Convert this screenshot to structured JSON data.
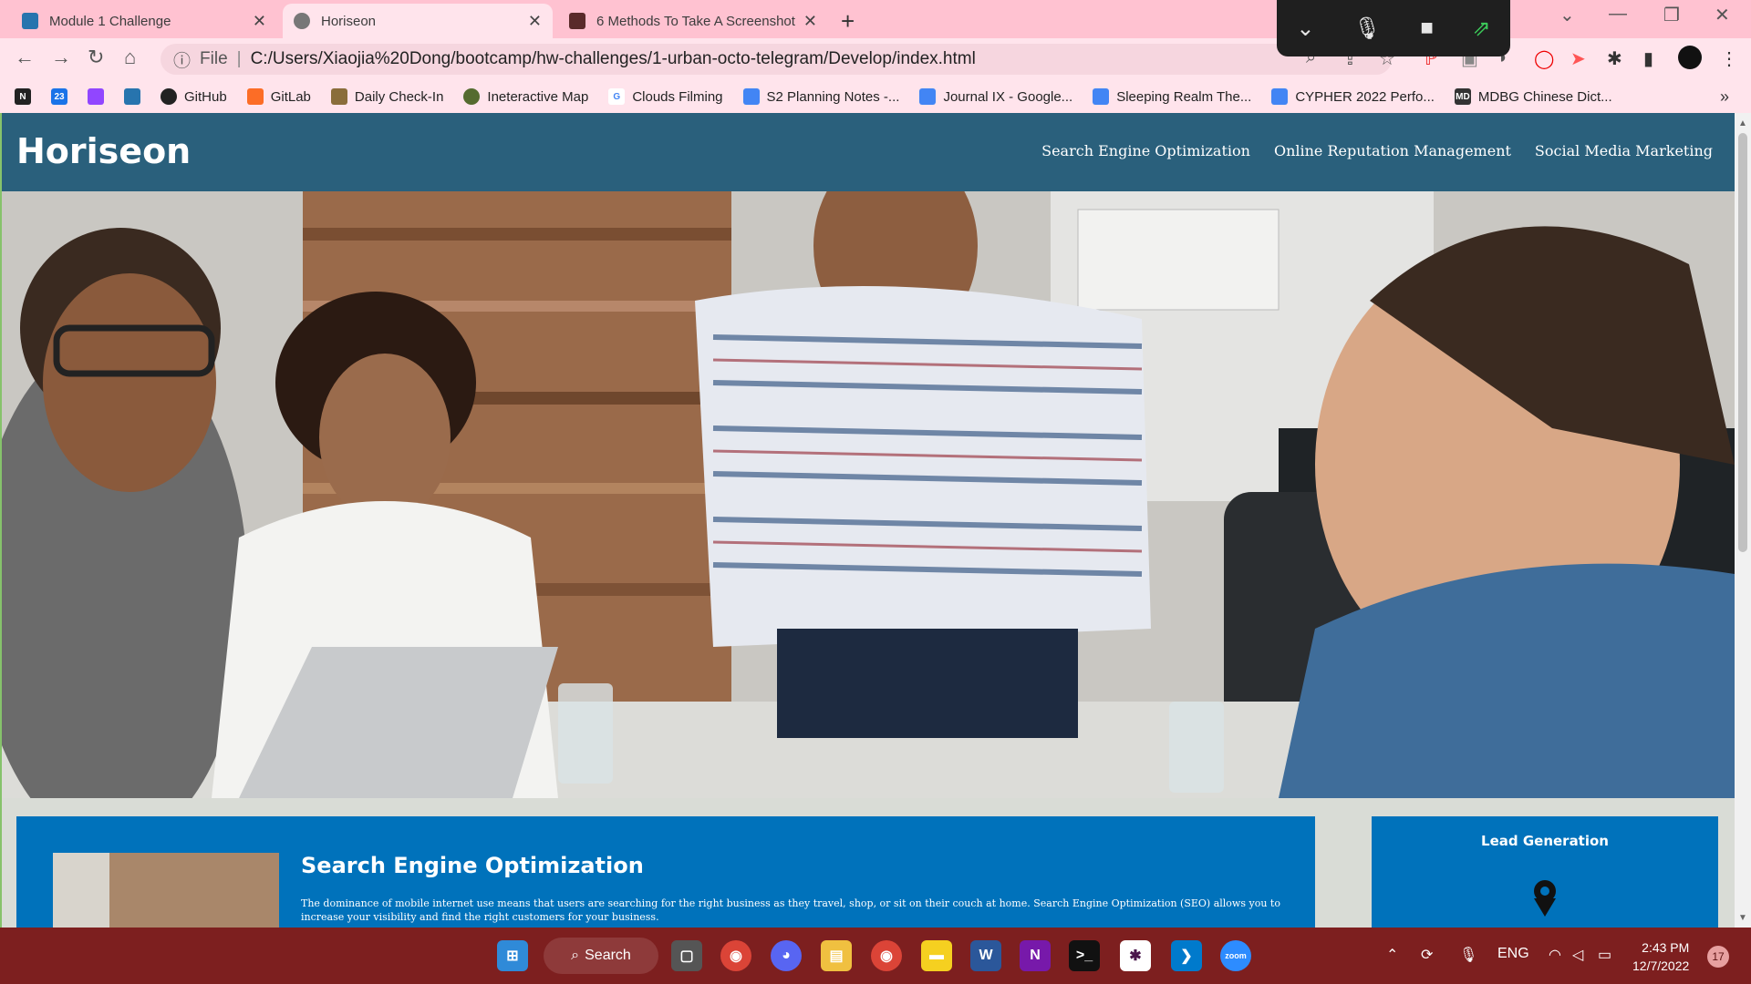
{
  "browser": {
    "tabs": [
      {
        "title": "Module 1 Challenge",
        "favicon": "ucla-icon",
        "active": false
      },
      {
        "title": "Horiseon",
        "favicon": "globe-icon",
        "active": true
      },
      {
        "title": "6 Methods To Take A Screenshot",
        "favicon": "screenshot-site-icon",
        "active": false
      }
    ],
    "url": {
      "scheme": "File",
      "path": "C:/Users/Xiaojia%20Dong/bootcamp/hw-challenges/1-urban-octo-telegram/Develop/index.html"
    },
    "bookmarks": [
      {
        "label": "",
        "icon": "notion-icon",
        "color": "#222222"
      },
      {
        "label": "",
        "icon": "calendar-icon",
        "color": "#1a73e8"
      },
      {
        "label": "",
        "icon": "twitch-icon",
        "color": "#9146ff"
      },
      {
        "label": "",
        "icon": "ucla-icon",
        "color": "#2774ae"
      },
      {
        "label": "GitHub",
        "icon": "github-icon",
        "color": "#222222"
      },
      {
        "label": "GitLab",
        "icon": "gitlab-icon",
        "color": "#fc6d26"
      },
      {
        "label": "Daily Check-In",
        "icon": "checkin-icon",
        "color": "#8a6d3b"
      },
      {
        "label": "Ineteractive Map",
        "icon": "map-icon",
        "color": "#556b2f"
      },
      {
        "label": "Clouds Filming",
        "icon": "google-icon",
        "color": "#4285f4"
      },
      {
        "label": "S2 Planning Notes -...",
        "icon": "docs-icon",
        "color": "#4285f4"
      },
      {
        "label": "Journal IX - Google...",
        "icon": "docs-icon",
        "color": "#4285f4"
      },
      {
        "label": "Sleeping Realm The...",
        "icon": "docs-icon",
        "color": "#4285f4"
      },
      {
        "label": "CYPHER 2022 Perfo...",
        "icon": "docs-icon",
        "color": "#4285f4"
      },
      {
        "label": "MDBG Chinese Dict...",
        "icon": "mdbg-icon",
        "color": "#333333"
      }
    ]
  },
  "site": {
    "logo": "Horiseon",
    "nav": [
      "Search Engine Optimization",
      "Online Reputation Management",
      "Social Media Marketing"
    ],
    "seo": {
      "title": "Search Engine Optimization",
      "text": "The dominance of mobile internet use means that users are searching for the right business as they travel, shop, or sit on their couch at home. Search Engine Optimization (SEO) allows you to increase your visibility and find the right customers for your business."
    },
    "lead": {
      "title": "Lead Generation",
      "icon": "lead-generation-icon"
    },
    "colors": {
      "header": "#2a607c",
      "content": "#0072bb",
      "background": "#d9dcd6"
    }
  },
  "taskbar": {
    "search_label": "Search",
    "language": "ENG",
    "time": "2:43 PM",
    "date": "12/7/2022",
    "notifications": "17",
    "apps": [
      "start-icon",
      "task-view-icon",
      "chrome-icon",
      "discord-icon",
      "file-explorer-icon",
      "chrome-icon",
      "sticky-notes-icon",
      "word-icon",
      "onenote-icon",
      "terminal-icon",
      "slack-icon",
      "vscode-icon",
      "zoom-icon"
    ]
  }
}
